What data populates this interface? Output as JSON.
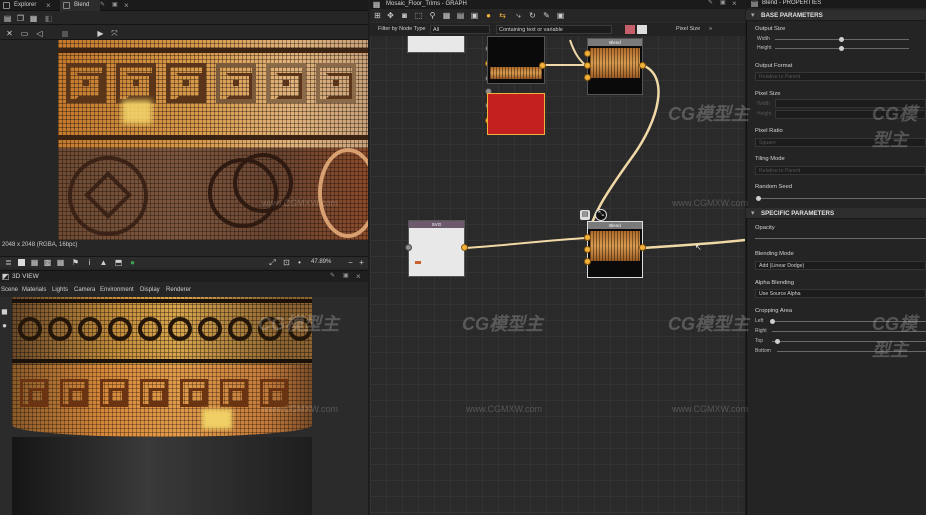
{
  "left_panel": {
    "tabs": [
      {
        "label": "Explorer"
      },
      {
        "label": "Blend"
      }
    ],
    "status": "2048 x 2048 (RGBA, 16bpc)",
    "zoom": "47.89%",
    "view3d": {
      "title": "3D VIEW",
      "menu": [
        "Scene",
        "Materials",
        "Lights",
        "Camera",
        "Environment",
        "Display",
        "Renderer"
      ]
    }
  },
  "graph": {
    "title": "Mosaic_Floor_Trims - GRAPH",
    "filter_label": "Filter by Node Type",
    "filter_value": "All",
    "search_placeholder": "Containing text or variable",
    "pixel_size_label": "Pixel Size",
    "nodes": {
      "blend_top": "Blend",
      "blend_mid": "Blend",
      "svg": "SVG"
    }
  },
  "properties": {
    "title": "Blend - PROPERTIES",
    "base_section": "BASE PARAMETERS",
    "output_size": {
      "label": "Output Size",
      "width": "Width",
      "height": "Height"
    },
    "output_format": {
      "label": "Output Format",
      "value": "Relative to Parent"
    },
    "pixel_size": {
      "label": "Pixel Size",
      "width": "Width",
      "height": "Height"
    },
    "pixel_ratio": {
      "label": "Pixel Ratio",
      "value": "Square"
    },
    "tiling_mode": {
      "label": "Tiling Mode",
      "value": "Relative to Parent"
    },
    "random_seed": {
      "label": "Random Seed"
    },
    "specific_section": "SPECIFIC PARAMETERS",
    "opacity": {
      "label": "Opacity"
    },
    "blending_mode": {
      "label": "Blending Mode",
      "value": "Add (Linear Dodge)"
    },
    "alpha_blending": {
      "label": "Alpha Blending",
      "value": "Use Source Alpha"
    },
    "cropping_area": {
      "label": "Cropping Area",
      "left": "Left",
      "right": "Right",
      "top": "Top",
      "bottom": "Bottom"
    }
  },
  "watermark": {
    "logo": "CG模型主",
    "url": "www.CGMXW.com"
  },
  "colors": {
    "accent_orange": "#f1b13a",
    "wire": "#f0d9a6",
    "red_node": "#c42020"
  }
}
